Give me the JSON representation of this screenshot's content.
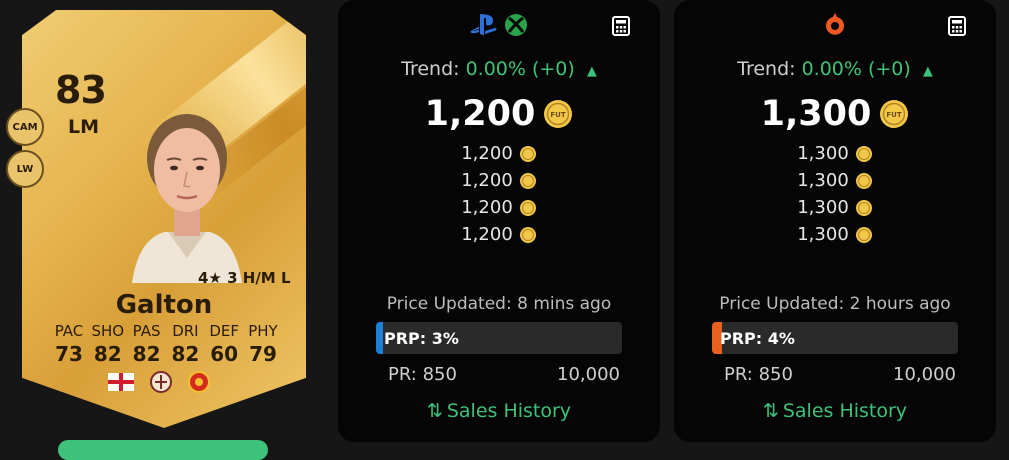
{
  "player": {
    "rating": "83",
    "position": "LM",
    "alt_positions": [
      "CAM",
      "LW"
    ],
    "skills_line": "4★ 3 H/M L",
    "name": "Galton",
    "stats": [
      {
        "label": "PAC",
        "value": "73"
      },
      {
        "label": "SHO",
        "value": "82"
      },
      {
        "label": "PAS",
        "value": "82"
      },
      {
        "label": "DRI",
        "value": "82"
      },
      {
        "label": "DEF",
        "value": "60"
      },
      {
        "label": "PHY",
        "value": "79"
      }
    ],
    "badges": [
      "england-flag-icon",
      "league-badge-icon",
      "club-crest-icon"
    ]
  },
  "panels": [
    {
      "platform_icons": [
        "playstation-icon",
        "xbox-icon"
      ],
      "trend_label": "Trend:",
      "trend_value": "0.00% (+0)",
      "main_price": "1,200",
      "recent_prices": [
        "1,200",
        "1,200",
        "1,200",
        "1,200"
      ],
      "updated": "Price Updated: 8 mins ago",
      "prp_label": "PRP: 3%",
      "prp_percent": 3,
      "prp_color": "#1e7fd6",
      "pr_min": "PR: 850",
      "pr_max": "10,000",
      "sales_label": "Sales History"
    },
    {
      "platform_icons": [
        "origin-pc-icon"
      ],
      "trend_label": "Trend:",
      "trend_value": "0.00% (+0)",
      "main_price": "1,300",
      "recent_prices": [
        "1,300",
        "1,300",
        "1,300",
        "1,300"
      ],
      "updated": "Price Updated: 2 hours ago",
      "prp_label": "PRP: 4%",
      "prp_percent": 4,
      "prp_color": "#e8601c",
      "pr_min": "PR: 850",
      "pr_max": "10,000",
      "sales_label": "Sales History"
    }
  ],
  "coin_label": "FUT",
  "colors": {
    "accent_green": "#3ec27a",
    "card_gold": "#e6b54f",
    "panel_bg": "#050505"
  }
}
